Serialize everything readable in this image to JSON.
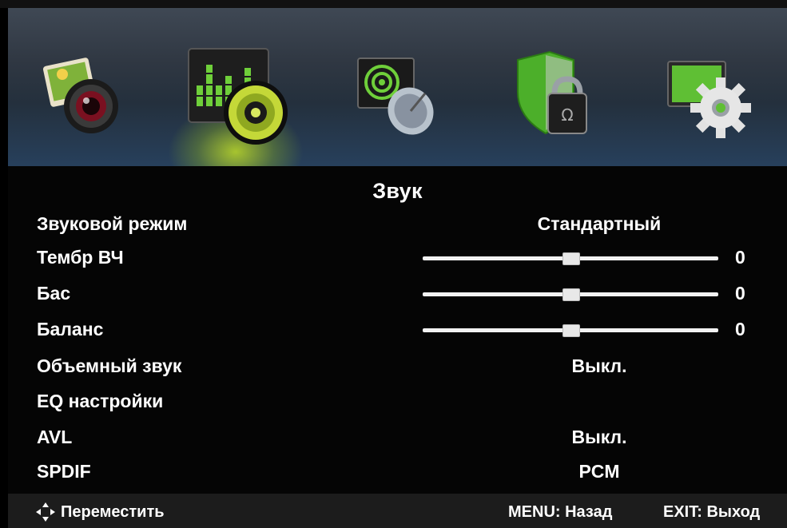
{
  "top_menu": {
    "items": [
      {
        "icon": "picture-camera-icon",
        "active": false
      },
      {
        "icon": "sound-speaker-icon",
        "active": true
      },
      {
        "icon": "channel-satellite-icon",
        "active": false
      },
      {
        "icon": "lock-shield-icon",
        "active": false
      },
      {
        "icon": "settings-gear-icon",
        "active": false
      }
    ],
    "accent": "#a8c81e"
  },
  "panel": {
    "title": "Звук",
    "rows": [
      {
        "label": "Звуковой режим",
        "value": "Стандартный"
      },
      {
        "label": "Тембр ВЧ",
        "value": "0",
        "slider": 0.5
      },
      {
        "label": "Бас",
        "value": "0",
        "slider": 0.5
      },
      {
        "label": "Баланс",
        "value": "0",
        "slider": 0.5
      },
      {
        "label": "Объемный звук",
        "value": "Выкл."
      },
      {
        "label": "EQ настройки",
        "value": ""
      },
      {
        "label": "AVL",
        "value": "Выкл."
      },
      {
        "label": "SPDIF",
        "value": "PCM"
      }
    ]
  },
  "hints": {
    "move": "Переместить",
    "menu": "MENU: Назад",
    "exit": "EXIT: Выход"
  }
}
